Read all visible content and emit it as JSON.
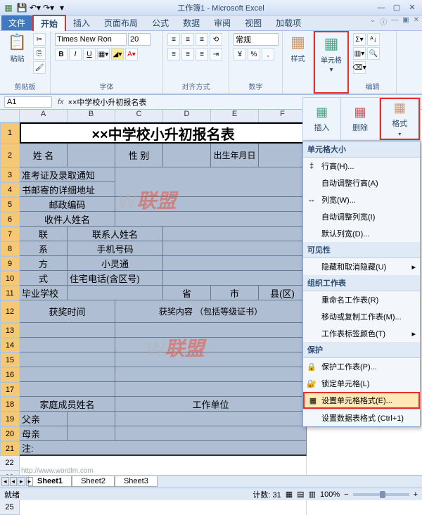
{
  "window": {
    "title": "工作簿1 - Microsoft Excel"
  },
  "tabs": {
    "file": "文件",
    "home": "开始",
    "insert": "插入",
    "layout": "页面布局",
    "formula": "公式",
    "data": "数据",
    "review": "审阅",
    "view": "视图",
    "addin": "加载项"
  },
  "ribbon": {
    "font_name": "Times New Ron",
    "font_size": "20",
    "clipboard": "剪贴板",
    "paste": "粘贴",
    "font": "字体",
    "align": "对齐方式",
    "number_label": "数字",
    "number_fmt": "常规",
    "style": "样式",
    "cells": "单元格",
    "edit": "编辑"
  },
  "namebox": "A1",
  "formula": "××中学校小升初报名表",
  "mini_panel": {
    "insert": "插入",
    "delete": "删除",
    "format": "格式"
  },
  "menu": {
    "g1": "单元格大小",
    "row_h": "行高(H)...",
    "auto_row": "自动调整行高(A)",
    "col_w": "列宽(W)...",
    "auto_col": "自动调整列宽(I)",
    "def_col": "默认列宽(D)...",
    "g2": "可见性",
    "hide": "隐藏和取消隐藏(U)",
    "g3": "组织工作表",
    "rename": "重命名工作表(R)",
    "move": "移动或复制工作表(M)...",
    "tabcolor": "工作表标签颜色(T)",
    "g4": "保护",
    "protect": "保护工作表(P)...",
    "lock": "锁定单元格(L)",
    "fmt": "设置单元格格式(E)...",
    "tblfmt": "设置数据表格式 (Ctrl+1)"
  },
  "cells": {
    "title": "××中学校小升初报名表",
    "r2a": "姓 名",
    "r2c": "性 别",
    "r2e": "出生年月日",
    "r3a": "准考证及录取通知",
    "r4a": "书邮寄的详细地址",
    "r5a": "邮政编码",
    "r6a": "收件人姓名",
    "r7a": "联",
    "r7b": "联系人姓名",
    "r8a": "系",
    "r8b": "手机号码",
    "r9a": "方",
    "r9b": "小灵通",
    "r10a": "式",
    "r10b": "住宅电话(含区号)",
    "r11a": "毕业学校",
    "r11c": "省",
    "r11d": "市",
    "r11e": "县(区)",
    "r12a": "获奖时间",
    "r12c": "获奖内容 （包括等级证书）",
    "r18a": "家庭成员姓名",
    "r18c": "工作单位",
    "r19a": "父亲",
    "r20a": "母亲",
    "r21a": "注:"
  },
  "sheets": {
    "s1": "Sheet1",
    "s2": "Sheet2",
    "s3": "Sheet3"
  },
  "status": {
    "ready": "就绪",
    "count": "计数: 31",
    "zoom": "100%"
  },
  "url": "http://www.wordlm.com"
}
